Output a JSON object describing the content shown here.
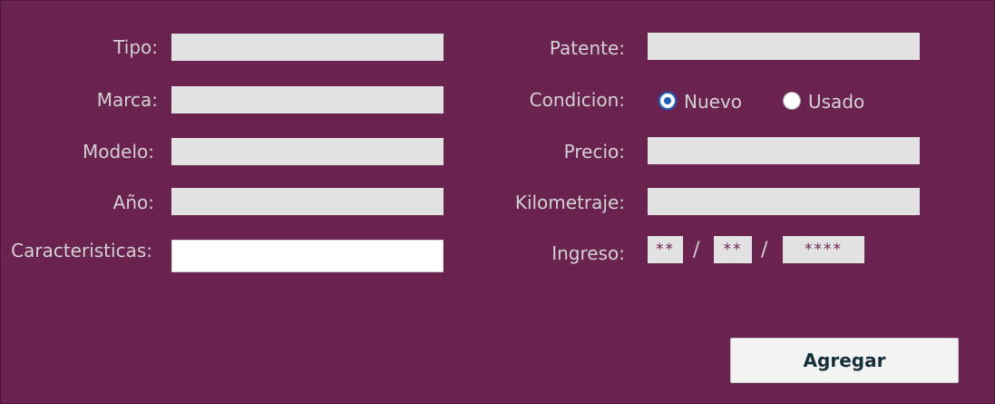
{
  "form": {
    "left": {
      "tipo_label": "Tipo:",
      "marca_label": "Marca:",
      "modelo_label": "Modelo:",
      "anio_label": "Año:",
      "caracteristicas_label": "Caracteristicas:",
      "tipo_value": "",
      "marca_value": "",
      "modelo_value": "",
      "anio_value": "",
      "caracteristicas_value": ""
    },
    "right": {
      "patente_label": "Patente:",
      "condicion_label": "Condicion:",
      "precio_label": "Precio:",
      "kilometraje_label": "Kilometraje:",
      "ingreso_label": "Ingreso:",
      "patente_value": "",
      "precio_value": "",
      "kilometraje_value": ""
    },
    "condicion": {
      "options": [
        "Nuevo",
        "Usado"
      ],
      "selected": "Nuevo"
    },
    "ingreso": {
      "day_mask": "**",
      "month_mask": "**",
      "year_mask": "****",
      "separator": "/"
    },
    "submit_label": "Agregar"
  },
  "colors": {
    "background": "#6a234f",
    "label_text": "#d4d0d3",
    "field_bg": "#e3e2e3",
    "radio_selected": "#1f5fb5"
  }
}
